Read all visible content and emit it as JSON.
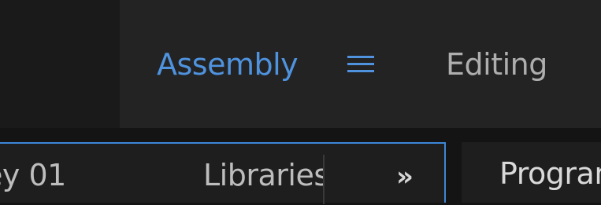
{
  "workspaces": {
    "active": "Assembly",
    "next": "Editing"
  },
  "panels": {
    "left": {
      "tabs": [
        "ey 01",
        "Libraries"
      ],
      "overflow_glyph": "»"
    },
    "right": {
      "tab": "Program"
    }
  },
  "icons": {
    "menu": "hamburger-menu-icon",
    "overflow": "double-chevron-right-icon"
  },
  "colors": {
    "active_tab": "#4f93df",
    "panel_focus_border": "#3c87d8",
    "inactive_text": "#aeaeae"
  }
}
